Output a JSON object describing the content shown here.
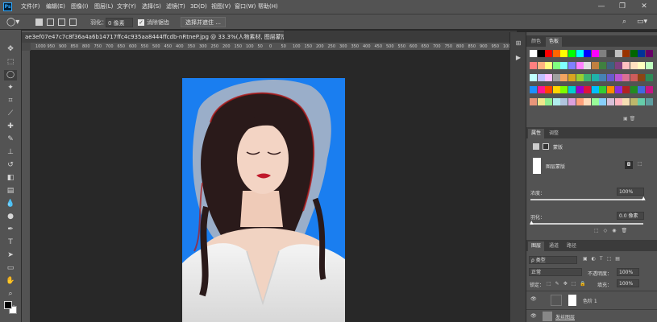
{
  "menubar": {
    "logo": "Ps",
    "items": [
      "文件(F)",
      "编辑(E)",
      "图像(I)",
      "图层(L)",
      "文字(Y)",
      "选择(S)",
      "滤镜(T)",
      "3D(D)",
      "视图(V)",
      "窗口(W)",
      "帮助(H)"
    ],
    "controls": [
      "—",
      "❐",
      "✕"
    ]
  },
  "options": {
    "feather_label": "羽化：",
    "feather_value": "0 像素",
    "antialias_label": "消除锯齿",
    "select_mask_button": "选择并遮住 ..."
  },
  "document": {
    "tab_title": "ae3ef07e47c7c8f36a4a6b14717ffc4c935aa8444ffcdb-nRtneP.jpg @ 33.3%(人物素材, 图层蒙版/8) *",
    "close": "×"
  },
  "ruler": {
    "ticks": [
      "1000",
      "950",
      "900",
      "850",
      "800",
      "750",
      "700",
      "650",
      "600",
      "550",
      "500",
      "450",
      "400",
      "350",
      "300",
      "250",
      "200",
      "150",
      "100",
      "50",
      "0",
      "50",
      "100",
      "150",
      "200",
      "250",
      "300",
      "350",
      "400",
      "450",
      "500",
      "550",
      "600",
      "650",
      "700",
      "750",
      "800",
      "850",
      "900",
      "950",
      "1000",
      "1050"
    ]
  },
  "swatches_panel": {
    "tabs": [
      "颜色",
      "色板"
    ],
    "colors": [
      "#ffffff",
      "#000000",
      "#ff0000",
      "#ff6600",
      "#ffff00",
      "#00ff00",
      "#00ffff",
      "#0000ff",
      "#ff00ff",
      "#808080",
      "#404040",
      "#c0c0c0",
      "#993300",
      "#006600",
      "#003399",
      "#660066",
      "#ff8080",
      "#ffb380",
      "#ffff80",
      "#80ff80",
      "#80ffff",
      "#8080ff",
      "#ff80ff",
      "#e0e0e0",
      "#c08040",
      "#408040",
      "#406080",
      "#804080",
      "#ffc0c0",
      "#ffe0c0",
      "#ffffc0",
      "#c0ffc0",
      "#c0ffff",
      "#c0c0ff",
      "#ffc0ff",
      "#a0a0a0",
      "#f4a460",
      "#daa520",
      "#9acd32",
      "#3cb371",
      "#20b2aa",
      "#4682b4",
      "#6a5acd",
      "#ba55d3",
      "#db7093",
      "#cd5c5c",
      "#8b4513",
      "#2e8b57",
      "#1e90ff",
      "#ff1493",
      "#ff4500",
      "#ffd700",
      "#7cfc00",
      "#00ced1",
      "#9400d3",
      "#dc143c",
      "#00bfff",
      "#32cd32",
      "#ff8c00",
      "#8a2be2",
      "#b22222",
      "#228b22",
      "#4169e1",
      "#c71585",
      "#e9967a",
      "#f0e68c",
      "#90ee90",
      "#afeeee",
      "#b0c4de",
      "#dda0dd",
      "#ffa07a",
      "#ffdab9",
      "#98fb98",
      "#87cefa",
      "#d8bfd8",
      "#ffb6c1",
      "#f5deb3",
      "#bdb76b",
      "#66cdaa",
      "#5f9ea0"
    ]
  },
  "properties_panel": {
    "tabs": [
      "属性",
      "调整"
    ],
    "mask_label": "蒙版",
    "layer_mask_label": "图层蒙版",
    "density_label": "浓度：",
    "density_value": "100%",
    "feather_label": "羽化：",
    "feather_value": "0.0 像素"
  },
  "layers_panel": {
    "tabs": [
      "图层",
      "通道",
      "路径"
    ],
    "kind_label": "ρ 类型",
    "blend_mode": "正常",
    "opacity_label": "不透明度：",
    "opacity_value": "100%",
    "lock_label": "锁定：",
    "fill_label": "填充：",
    "fill_value": "100%",
    "layers": [
      {
        "name": "色阶 1",
        "visible": true
      },
      {
        "name": "发丝图层",
        "visible": true
      }
    ]
  }
}
